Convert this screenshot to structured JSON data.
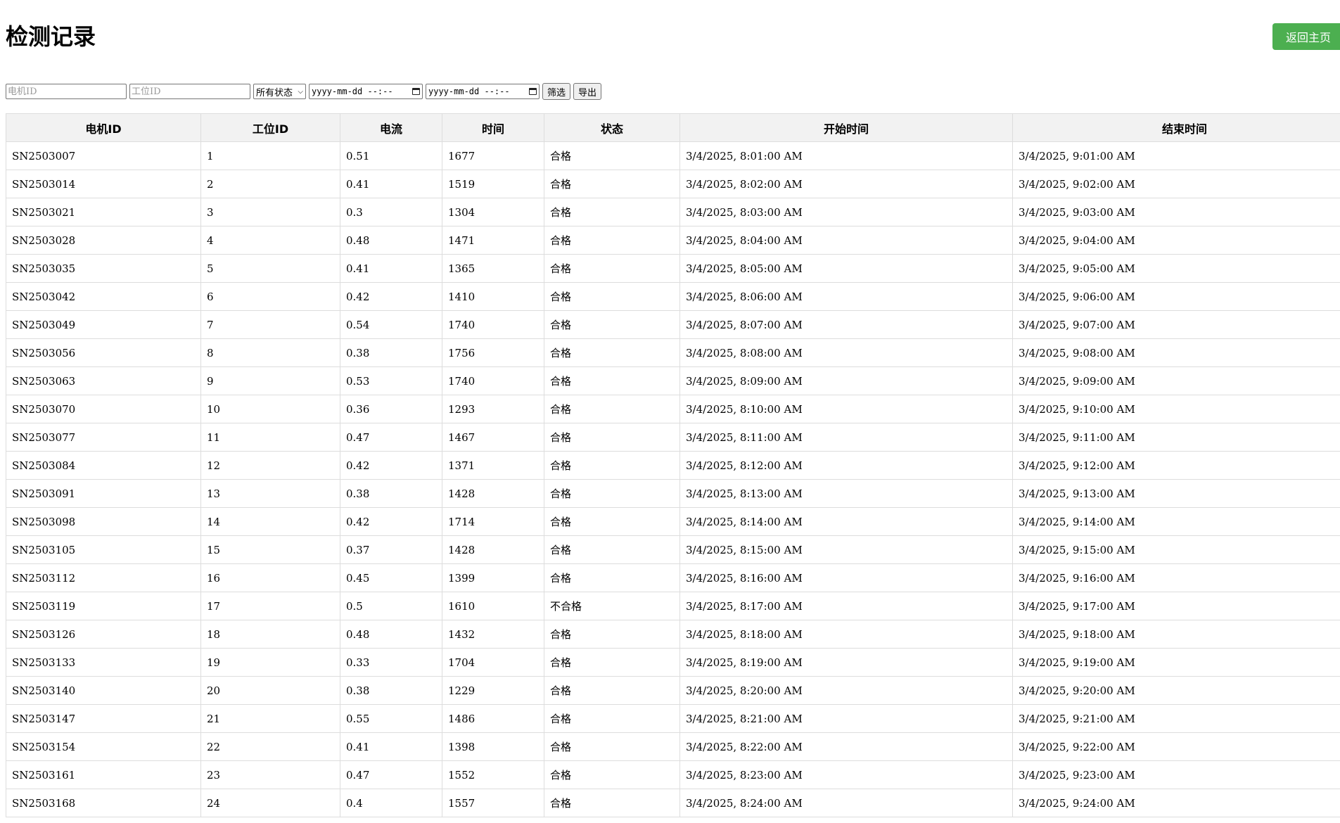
{
  "header": {
    "title": "检测记录",
    "home_label": "返回主页"
  },
  "filters": {
    "motor_id_placeholder": "电机ID",
    "station_id_placeholder": "工位ID",
    "status_selected": "所有状态",
    "start_date_placeholder": "yyyy-mm-dd --:--",
    "end_date_placeholder": "yyyy-mm-dd --:--",
    "filter_label": "筛选",
    "export_label": "导出"
  },
  "table": {
    "columns": [
      "电机ID",
      "工位ID",
      "电流",
      "时间",
      "状态",
      "开始时间",
      "结束时间"
    ],
    "rows": [
      [
        "SN2503007",
        "1",
        "0.51",
        "1677",
        "合格",
        "3/4/2025, 8:01:00 AM",
        "3/4/2025, 9:01:00 AM"
      ],
      [
        "SN2503014",
        "2",
        "0.41",
        "1519",
        "合格",
        "3/4/2025, 8:02:00 AM",
        "3/4/2025, 9:02:00 AM"
      ],
      [
        "SN2503021",
        "3",
        "0.3",
        "1304",
        "合格",
        "3/4/2025, 8:03:00 AM",
        "3/4/2025, 9:03:00 AM"
      ],
      [
        "SN2503028",
        "4",
        "0.48",
        "1471",
        "合格",
        "3/4/2025, 8:04:00 AM",
        "3/4/2025, 9:04:00 AM"
      ],
      [
        "SN2503035",
        "5",
        "0.41",
        "1365",
        "合格",
        "3/4/2025, 8:05:00 AM",
        "3/4/2025, 9:05:00 AM"
      ],
      [
        "SN2503042",
        "6",
        "0.42",
        "1410",
        "合格",
        "3/4/2025, 8:06:00 AM",
        "3/4/2025, 9:06:00 AM"
      ],
      [
        "SN2503049",
        "7",
        "0.54",
        "1740",
        "合格",
        "3/4/2025, 8:07:00 AM",
        "3/4/2025, 9:07:00 AM"
      ],
      [
        "SN2503056",
        "8",
        "0.38",
        "1756",
        "合格",
        "3/4/2025, 8:08:00 AM",
        "3/4/2025, 9:08:00 AM"
      ],
      [
        "SN2503063",
        "9",
        "0.53",
        "1740",
        "合格",
        "3/4/2025, 8:09:00 AM",
        "3/4/2025, 9:09:00 AM"
      ],
      [
        "SN2503070",
        "10",
        "0.36",
        "1293",
        "合格",
        "3/4/2025, 8:10:00 AM",
        "3/4/2025, 9:10:00 AM"
      ],
      [
        "SN2503077",
        "11",
        "0.47",
        "1467",
        "合格",
        "3/4/2025, 8:11:00 AM",
        "3/4/2025, 9:11:00 AM"
      ],
      [
        "SN2503084",
        "12",
        "0.42",
        "1371",
        "合格",
        "3/4/2025, 8:12:00 AM",
        "3/4/2025, 9:12:00 AM"
      ],
      [
        "SN2503091",
        "13",
        "0.38",
        "1428",
        "合格",
        "3/4/2025, 8:13:00 AM",
        "3/4/2025, 9:13:00 AM"
      ],
      [
        "SN2503098",
        "14",
        "0.42",
        "1714",
        "合格",
        "3/4/2025, 8:14:00 AM",
        "3/4/2025, 9:14:00 AM"
      ],
      [
        "SN2503105",
        "15",
        "0.37",
        "1428",
        "合格",
        "3/4/2025, 8:15:00 AM",
        "3/4/2025, 9:15:00 AM"
      ],
      [
        "SN2503112",
        "16",
        "0.45",
        "1399",
        "合格",
        "3/4/2025, 8:16:00 AM",
        "3/4/2025, 9:16:00 AM"
      ],
      [
        "SN2503119",
        "17",
        "0.5",
        "1610",
        "不合格",
        "3/4/2025, 8:17:00 AM",
        "3/4/2025, 9:17:00 AM"
      ],
      [
        "SN2503126",
        "18",
        "0.48",
        "1432",
        "合格",
        "3/4/2025, 8:18:00 AM",
        "3/4/2025, 9:18:00 AM"
      ],
      [
        "SN2503133",
        "19",
        "0.33",
        "1704",
        "合格",
        "3/4/2025, 8:19:00 AM",
        "3/4/2025, 9:19:00 AM"
      ],
      [
        "SN2503140",
        "20",
        "0.38",
        "1229",
        "合格",
        "3/4/2025, 8:20:00 AM",
        "3/4/2025, 9:20:00 AM"
      ],
      [
        "SN2503147",
        "21",
        "0.55",
        "1486",
        "合格",
        "3/4/2025, 8:21:00 AM",
        "3/4/2025, 9:21:00 AM"
      ],
      [
        "SN2503154",
        "22",
        "0.41",
        "1398",
        "合格",
        "3/4/2025, 8:22:00 AM",
        "3/4/2025, 9:22:00 AM"
      ],
      [
        "SN2503161",
        "23",
        "0.47",
        "1552",
        "合格",
        "3/4/2025, 8:23:00 AM",
        "3/4/2025, 9:23:00 AM"
      ],
      [
        "SN2503168",
        "24",
        "0.4",
        "1557",
        "合格",
        "3/4/2025, 8:24:00 AM",
        "3/4/2025, 9:24:00 AM"
      ]
    ]
  },
  "colors": {
    "home_button": "#4caf50",
    "header_bg": "#f2f2f2",
    "border": "#dddddd"
  }
}
